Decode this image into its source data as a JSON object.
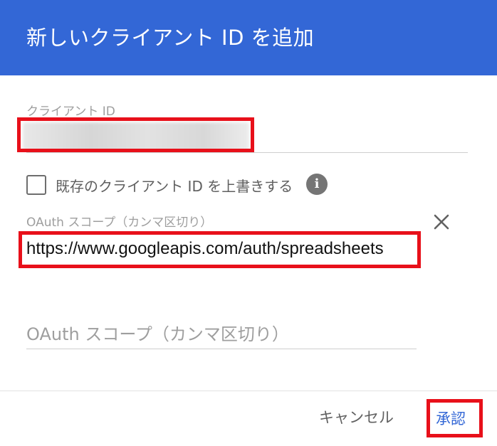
{
  "dialog": {
    "title": "新しいクライアント ID を追加",
    "client_id": {
      "label": "クライアント ID",
      "value_redacted": true
    },
    "overwrite_checkbox": {
      "label": "既存のクライアント ID を上書きする",
      "checked": false
    },
    "info_icon": "info-icon",
    "scopes": [
      {
        "label": "OAuth スコープ（カンマ区切り）",
        "value": "https://www.googleapis.com/auth/spreadsheets"
      },
      {
        "placeholder": "OAuth スコープ（カンマ区切り）",
        "value": ""
      }
    ],
    "footer": {
      "cancel_label": "キャンセル",
      "approve_label": "承認"
    }
  },
  "colors": {
    "header_background": "#3367d6",
    "highlight_border": "#e8101a",
    "primary_button_text": "#3367d6"
  }
}
